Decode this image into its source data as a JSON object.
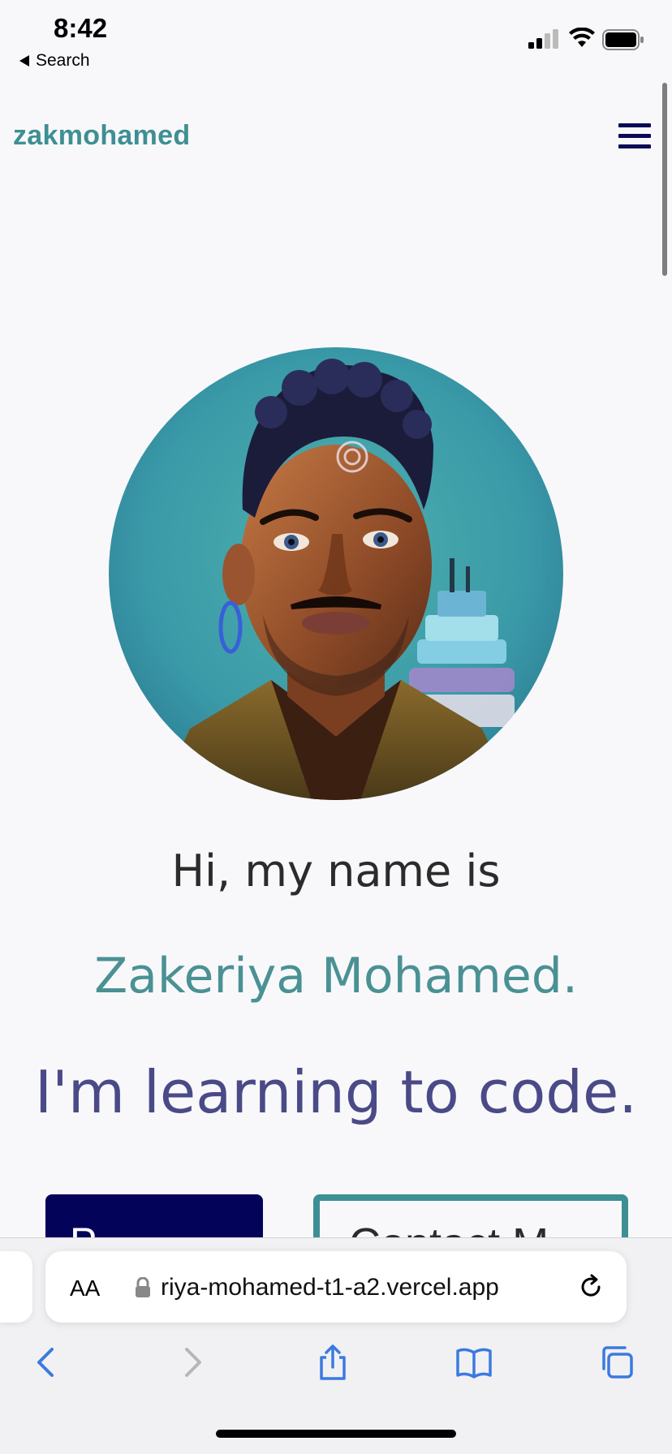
{
  "status_bar": {
    "time": "8:42",
    "back_label": "Search"
  },
  "site": {
    "logo": "zakmohamed",
    "menu_icon": "hamburger-menu-icon",
    "greeting": "Hi, my name is",
    "name": "Zakeriya Mohamed.",
    "tagline": "I'm learning to code.",
    "btn_primary_partial": "P",
    "btn_secondary_partial": "Contact M",
    "colors": {
      "logo": "#3e8f93",
      "name": "#4a9194",
      "tagline": "#4a4a88",
      "primary_button": "#04035a",
      "menu": "#0b0a57"
    }
  },
  "safari": {
    "text_size_label": "AA",
    "url": "riya-mohamed-t1-a2.vercel.app"
  }
}
